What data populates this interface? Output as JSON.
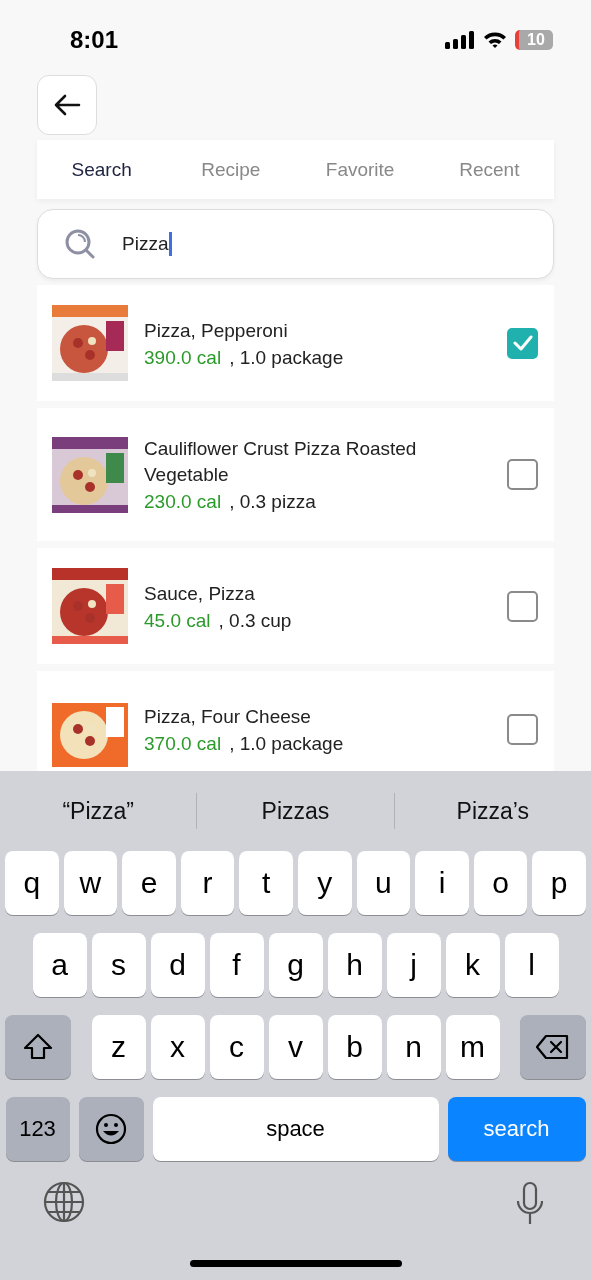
{
  "status_bar": {
    "time": "8:01",
    "battery": "10"
  },
  "tabs": [
    {
      "label": "Search",
      "selected": true
    },
    {
      "label": "Recipe",
      "selected": false
    },
    {
      "label": "Favorite",
      "selected": false
    },
    {
      "label": "Recent",
      "selected": false
    }
  ],
  "search": {
    "value": "Pizza"
  },
  "results": [
    {
      "name": "Pizza, Pepperoni",
      "calories": "390.0 cal",
      "amount": ", 1.0 package",
      "checked": true,
      "kind": "picture"
    },
    {
      "name": "Cauliflower Crust Pizza Roasted Vegetable",
      "calories": "230.0 cal",
      "amount": ", 0.3 pizza",
      "checked": false,
      "kind": "picture"
    },
    {
      "name": "Sauce, Pizza",
      "calories": "45.0 cal",
      "amount": ", 0.3 cup",
      "checked": false,
      "kind": "picture"
    },
    {
      "name": "Pizza, Four Cheese",
      "calories": "370.0 cal",
      "amount": ", 1.0 package",
      "checked": false,
      "kind": "picture"
    }
  ],
  "keyboard": {
    "suggestions": [
      "“Pizza”",
      "Pizzas",
      "Pizza’s"
    ],
    "rows": [
      [
        "q",
        "w",
        "e",
        "r",
        "t",
        "y",
        "u",
        "i",
        "o",
        "p"
      ],
      [
        "a",
        "s",
        "d",
        "f",
        "g",
        "h",
        "j",
        "k",
        "l"
      ],
      [
        "z",
        "x",
        "c",
        "v",
        "b",
        "n",
        "m"
      ]
    ],
    "numbers_key": "123",
    "space_key": "space",
    "action_key": "search"
  }
}
